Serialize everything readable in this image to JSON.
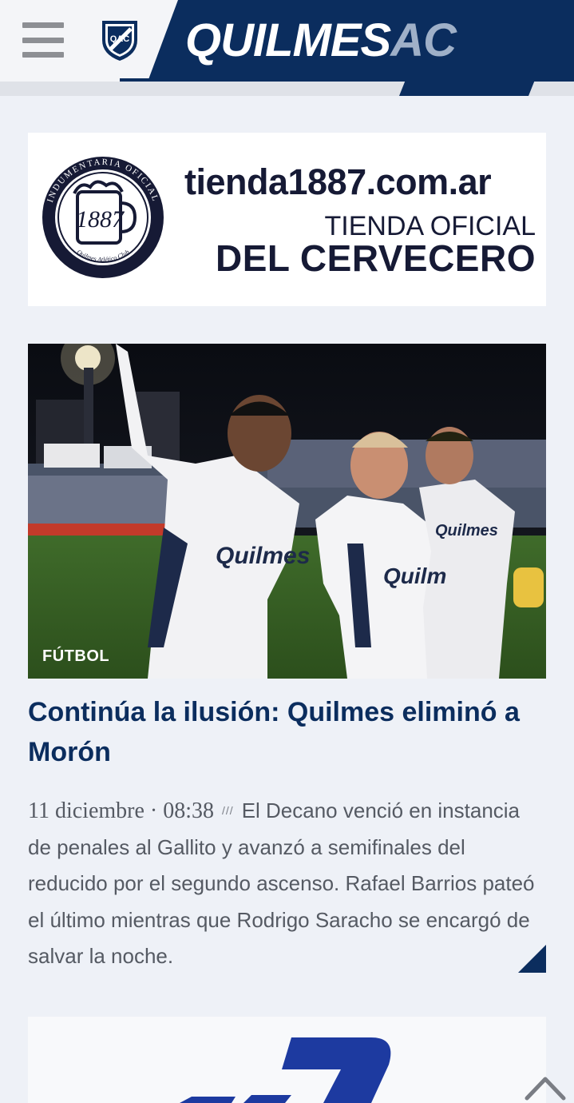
{
  "header": {
    "brand_primary": "QUILMES",
    "brand_secondary": "AC",
    "crest_text": "QAC",
    "menu_icon": "hamburger-menu-icon",
    "colors": {
      "navy": "#0b2d5e",
      "light": "#f4f5f8",
      "accent_grey": "#9fb0c8"
    }
  },
  "ad_banner": {
    "url": "tienda1887.com.ar",
    "line1": "TIENDA OFICIAL",
    "line2": "DEL CERVECERO",
    "logo": {
      "ring_text": "INDUMENTARIA OFICIAL",
      "number": "1887",
      "bottom_text": "Quilmes Atlético Club"
    }
  },
  "article": {
    "category": "FÚTBOL",
    "headline": "Continúa la ilusión: Quilmes eliminó a Morón",
    "date": "11 diciembre · 08:38",
    "separator": "///",
    "excerpt": "El Decano venció en instancia de penales al Gallito y avanzó a semifinales del reducido por el segundo ascenso. Rafael Barrios pateó el último mientras que Rodrigo Saracho se encargó de salvar la noche."
  },
  "bottom_ad": {
    "logo_icon": "sponsor-logo-icon"
  },
  "scroll_top_icon": "chevron-up-icon"
}
